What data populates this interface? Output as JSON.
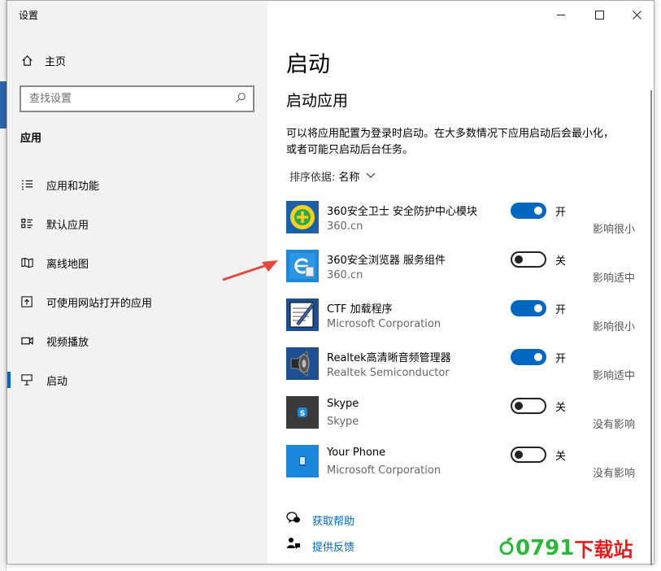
{
  "window": {
    "title": "设置"
  },
  "sidebar": {
    "home_label": "主页",
    "search_placeholder": "查找设置",
    "section_title": "应用",
    "items": [
      {
        "label": "应用和功能",
        "icon": "list-icon"
      },
      {
        "label": "默认应用",
        "icon": "default-apps-icon"
      },
      {
        "label": "离线地图",
        "icon": "map-icon"
      },
      {
        "label": "可使用网站打开的应用",
        "icon": "web-apps-icon"
      },
      {
        "label": "视频播放",
        "icon": "video-icon"
      },
      {
        "label": "启动",
        "icon": "startup-icon",
        "active": true
      }
    ]
  },
  "main": {
    "title": "启动",
    "subtitle": "启动应用",
    "description": "可以将应用配置为登录时启动。在大多数情况下应用启动后会最小化，或者可能只启动后台任务。",
    "sort_label": "排序依据:",
    "sort_value": "名称",
    "apps": [
      {
        "name": "360安全卫士 安全防护中心模块",
        "publisher": "360.cn",
        "on": true,
        "state": "开",
        "impact": "影响很小",
        "icon": "360-safe-icon"
      },
      {
        "name": "360安全浏览器 服务组件",
        "publisher": "360.cn",
        "on": false,
        "state": "关",
        "impact": "影响适中",
        "icon": "360-browser-icon"
      },
      {
        "name": "CTF 加载程序",
        "publisher": "Microsoft Corporation",
        "on": true,
        "state": "开",
        "impact": "影响很小",
        "icon": "ctf-loader-icon"
      },
      {
        "name": "Realtek高清晰音频管理器",
        "publisher": "Realtek Semiconductor",
        "on": true,
        "state": "开",
        "impact": "影响适中",
        "icon": "realtek-speaker-icon"
      },
      {
        "name": "Skype",
        "publisher": "Skype",
        "on": false,
        "state": "关",
        "impact": "没有影响",
        "icon": "skype-icon"
      },
      {
        "name": "Your Phone",
        "publisher": "Microsoft Corporation",
        "on": false,
        "state": "关",
        "impact": "没有影响",
        "icon": "your-phone-icon"
      }
    ],
    "help_link": "获取帮助",
    "feedback_link": "提供反馈"
  },
  "watermark": {
    "left": "0791",
    "right": "下载站"
  },
  "colors": {
    "accent": "#0067c0",
    "sidebar_bg": "#f2f2f2",
    "arrow": "#e8453c"
  }
}
